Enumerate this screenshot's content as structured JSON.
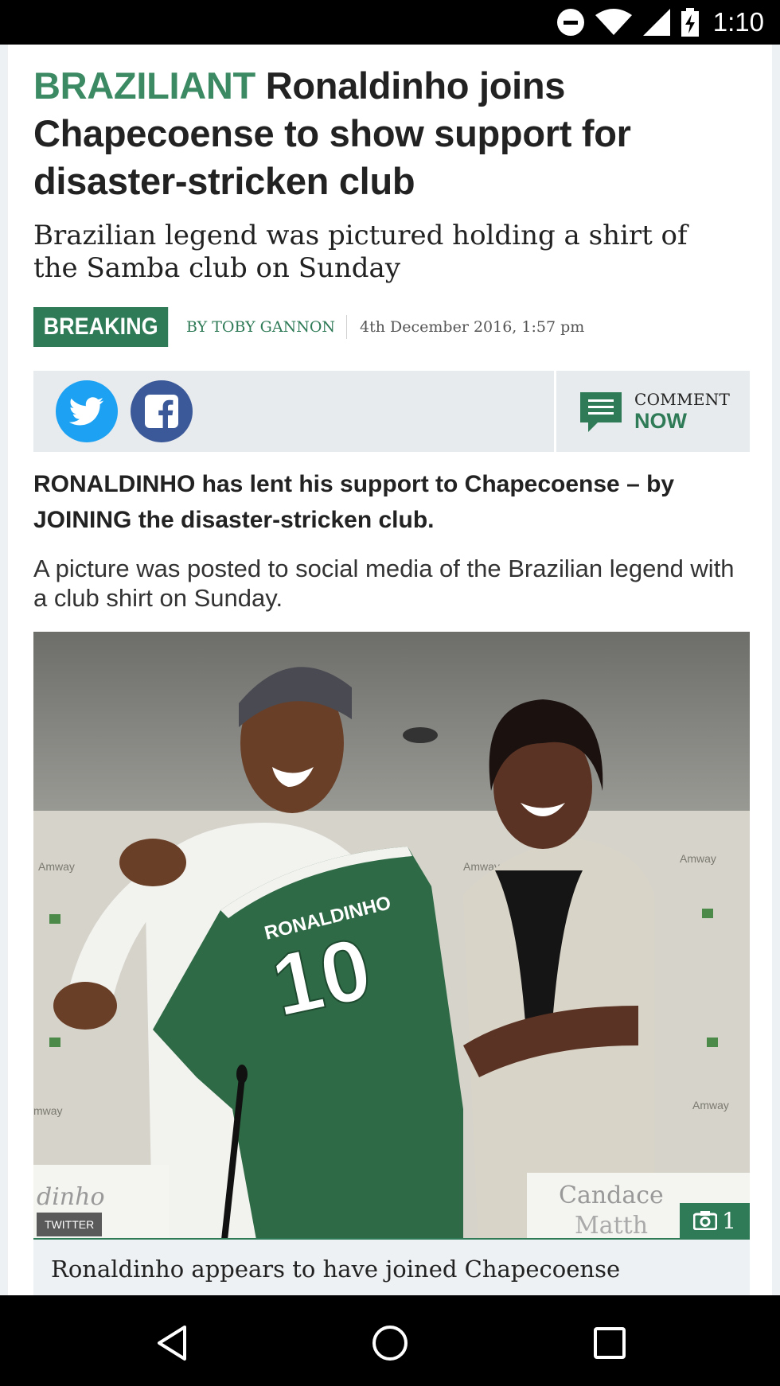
{
  "status_bar": {
    "time": "1:10",
    "icons": [
      "do-not-disturb-icon",
      "wifi-icon",
      "cell-signal-icon",
      "battery-charging-icon"
    ]
  },
  "article": {
    "kicker": "BRAZILIANT",
    "headline": "Ronaldinho joins Chapecoense to show support for disaster-stricken club",
    "subheadline": "Brazilian legend was pictured holding a shirt of the Samba club on Sunday",
    "badge": "BREAKING",
    "author": "BY TOBY GANNON",
    "timestamp": "4th December 2016, 1:57 pm",
    "lead": "RONALDINHO has lent his support to Chapecoense – by JOINING the disaster-stricken club.",
    "paragraph": "A picture was posted to social media of the Brazilian legend with a club shirt on Sunday."
  },
  "share": {
    "comment_line1": "COMMENT",
    "comment_line2": "NOW",
    "icons": [
      "twitter-icon",
      "facebook-icon",
      "comment-icon"
    ]
  },
  "photo": {
    "source": "TWITTER",
    "gallery_count": "1",
    "shirt_name": "RONALDINHO",
    "shirt_number": "10",
    "caption": "Ronaldinho appears to have joined Chapecoense",
    "colors": {
      "shirt": "#2d6a45",
      "backdrop": "#d6d3cb",
      "ceiling": "#7d7d78"
    }
  },
  "colors": {
    "accent": "#3b8a63",
    "badge": "#2f7b57",
    "twitter": "#1da1f2",
    "facebook": "#3b5998"
  },
  "nav_bar": {
    "icons": [
      "back-icon",
      "home-icon",
      "recents-icon"
    ]
  }
}
